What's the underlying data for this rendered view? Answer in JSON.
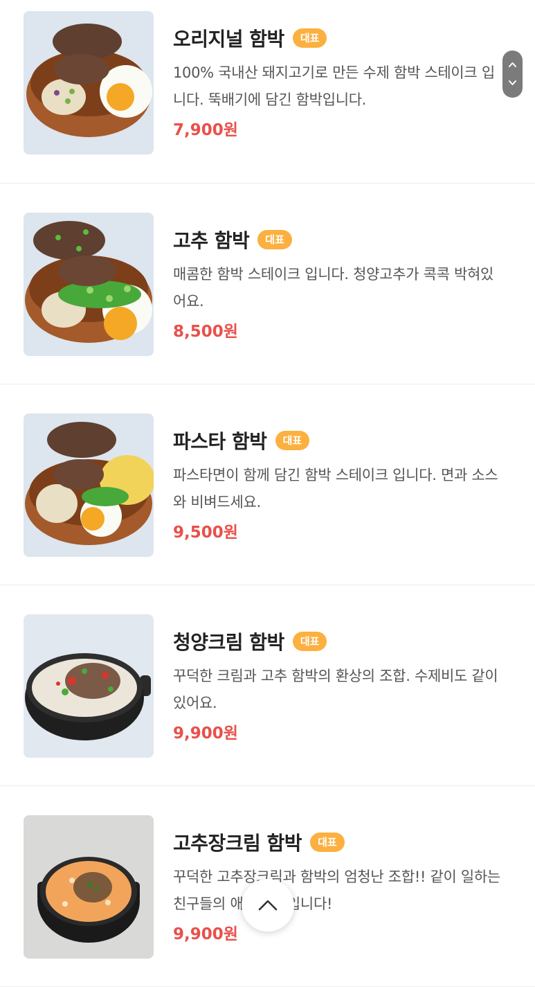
{
  "menu": {
    "items": [
      {
        "name": "오리지널 함박",
        "badge": "대표",
        "description": "100% 국내산 돼지고기로 만든 수제 함박 스테이크 입니다. 뚝배기에 담긴 함박입니다.",
        "price": "7,900원",
        "image_icon": "hamburg-steak-bowl-with-egg-photo"
      },
      {
        "name": "고추 함박",
        "badge": "대표",
        "description": "매콤한 함박 스테이크 입니다. 청양고추가 콕콕 박혀있어요.",
        "price": "8,500원",
        "image_icon": "pepper-hamburg-steak-bowl-photo"
      },
      {
        "name": "파스타 함박",
        "badge": "대표",
        "description": "파스타면이 함께 담긴 함박 스테이크 입니다. 면과 소스와 비벼드세요.",
        "price": "9,500원",
        "image_icon": "pasta-hamburg-steak-bowl-photo"
      },
      {
        "name": "청양크림 함박",
        "badge": "대표",
        "description": "꾸덕한 크림과 고추 함박의 환상의 조합. 수제비도 같이 있어요.",
        "price": "9,900원",
        "image_icon": "cream-hamburg-pot-photo"
      },
      {
        "name": "고추장크림 함박",
        "badge": "대표",
        "description": "꾸덕한 고추장크림과 함박의 엄청난 조합!! 같이 일하는 친구들의 애정메뉴 입니다!",
        "price": "9,900원",
        "image_icon": "gochujang-cream-hamburg-pot-photo"
      }
    ]
  },
  "colors": {
    "badge": "#fbb040",
    "price": "#e9504b",
    "name": "#222222",
    "description": "#555555"
  },
  "controls": {
    "scroll_up_icon": "chevron-up-icon",
    "scroll_down_icon": "chevron-down-icon",
    "scroll_to_top_icon": "chevron-up-icon"
  }
}
